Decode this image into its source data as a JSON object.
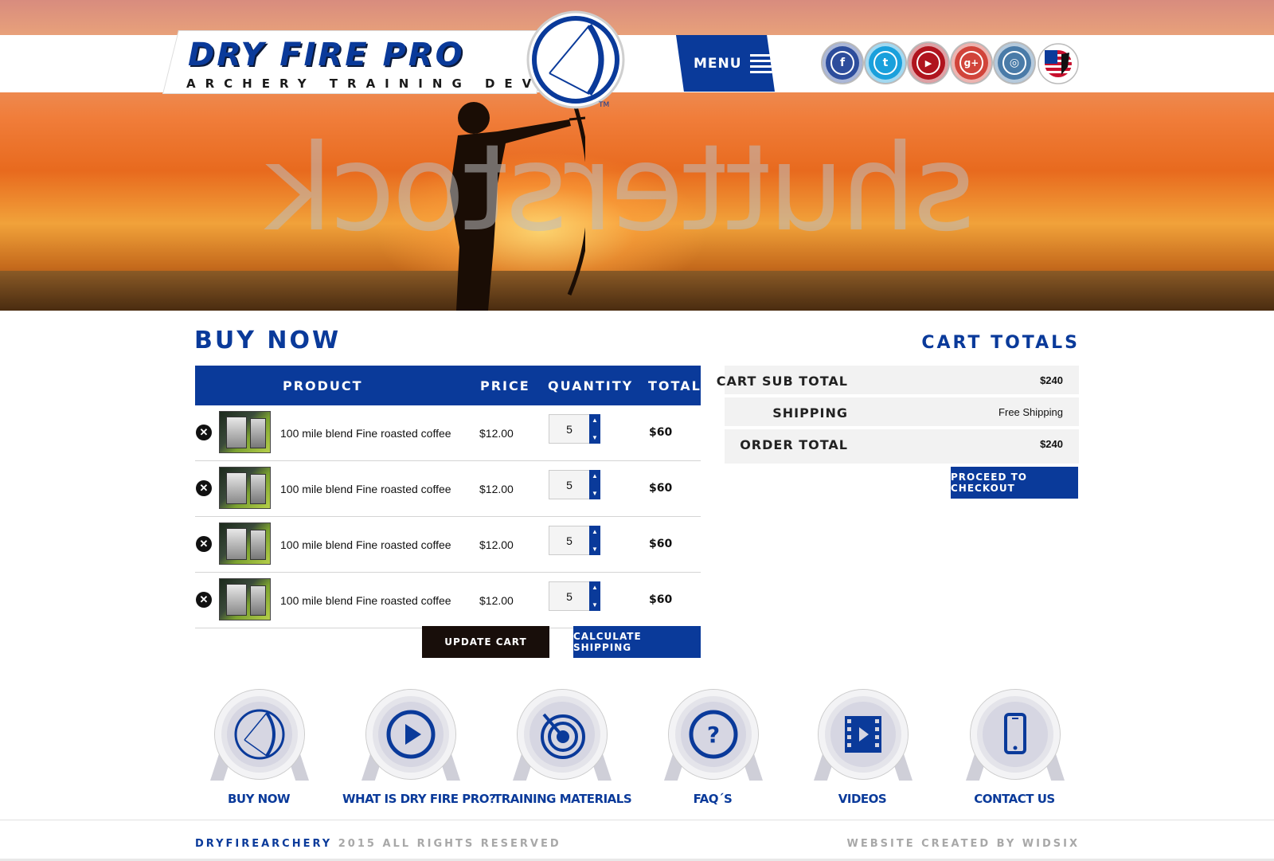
{
  "hero": {
    "watermark": "shutterstock"
  },
  "logo": {
    "title": "DRY FIRE PRO",
    "subtitle": "ARCHERY TRAINING DEVICE",
    "trademark": "TM"
  },
  "menu": {
    "label": "MENU"
  },
  "social": [
    {
      "name": "facebook",
      "glyph": "f",
      "color": "#2d4d9c"
    },
    {
      "name": "twitter",
      "glyph": "t",
      "color": "#1aa0dc"
    },
    {
      "name": "youtube",
      "glyph": "▶",
      "color": "#b0141e"
    },
    {
      "name": "google-plus",
      "glyph": "g+",
      "color": "#d1443a"
    },
    {
      "name": "instagram",
      "glyph": "◎",
      "color": "#4a7ba8"
    }
  ],
  "buy_now": {
    "title": "BUY NOW",
    "columns": {
      "product": "PRODUCT",
      "price": "PRICE",
      "quantity": "QUANTITY",
      "total": "TOTAL"
    },
    "rows": [
      {
        "name": "100 mile blend Fine roasted coffee",
        "price": "$12.00",
        "qty": "5",
        "total": "$60"
      },
      {
        "name": "100 mile blend Fine roasted coffee",
        "price": "$12.00",
        "qty": "5",
        "total": "$60"
      },
      {
        "name": "100 mile blend Fine roasted coffee",
        "price": "$12.00",
        "qty": "5",
        "total": "$60"
      },
      {
        "name": "100 mile blend Fine roasted coffee",
        "price": "$12.00",
        "qty": "5",
        "total": "$60"
      }
    ],
    "update_cart": "UPDATE CART",
    "calculate_shipping": "CALCULATE SHIPPING"
  },
  "cart_totals": {
    "title": "CART TOTALS",
    "sub_total_label": "CART SUB TOTAL",
    "sub_total_value": "$240",
    "shipping_label": "SHIPPING",
    "shipping_value": "Free Shipping",
    "order_total_label": "ORDER TOTAL",
    "order_total_value": "$240",
    "checkout": "PROCEED TO CHECKOUT"
  },
  "bottom_nav": [
    {
      "label": "BUY NOW",
      "icon": "bow-icon"
    },
    {
      "label": "WHAT IS DRY FIRE PRO?",
      "icon": "play-icon"
    },
    {
      "label": "TRAINING MATERIALS",
      "icon": "target-icon"
    },
    {
      "label": "FAQ´S",
      "icon": "question-icon"
    },
    {
      "label": "VIDEOS",
      "icon": "film-icon"
    },
    {
      "label": "CONTACT US",
      "icon": "phone-icon"
    }
  ],
  "footer": {
    "brand": "DRYFIREARCHERY",
    "rights": "2015 ALL RIGHTS RESERVED",
    "credit": "WEBSITE CREATED BY WIDSIX"
  },
  "colors": {
    "brand_blue": "#0a3a9a",
    "dark_button": "#180e0a"
  }
}
